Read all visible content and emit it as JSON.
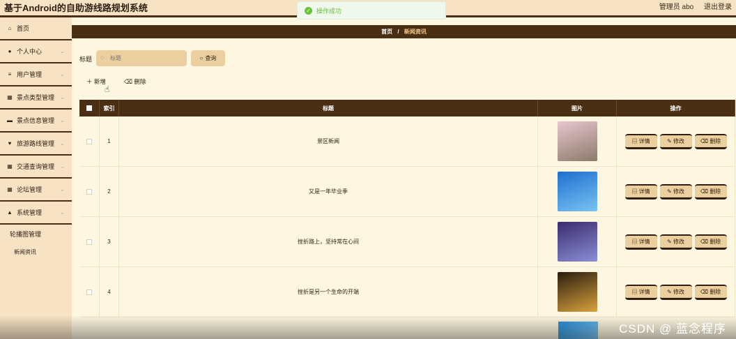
{
  "app": {
    "title": "基于Android的自助游线路规划系统"
  },
  "header": {
    "user_label": "管理员 abo",
    "logout": "退出登录"
  },
  "toast": {
    "message": "操作成功"
  },
  "sidebar": {
    "items": [
      {
        "label": "首页",
        "icon": "home-icon"
      },
      {
        "label": "个人中心",
        "icon": "user-icon"
      },
      {
        "label": "用户管理",
        "icon": "list-icon"
      },
      {
        "label": "景点类型管理",
        "icon": "grid-icon"
      },
      {
        "label": "景点信息管理",
        "icon": "chat-icon"
      },
      {
        "label": "旅游路线管理",
        "icon": "map-pin-icon"
      },
      {
        "label": "交通查询管理",
        "icon": "grid-icon"
      },
      {
        "label": "论坛管理",
        "icon": "grid-icon"
      },
      {
        "label": "系统管理",
        "icon": "user-icon"
      }
    ],
    "sub_items": [
      "轮播图管理",
      "新闻资讯"
    ]
  },
  "breadcrumb": {
    "home": "首页",
    "sep": "/",
    "current": "新闻资讯"
  },
  "search": {
    "label": "标题",
    "placeholder": "标题",
    "button": "查询"
  },
  "toolbar": {
    "add": "新增",
    "delete": "删除"
  },
  "table": {
    "columns": [
      "索引",
      "标题",
      "图片",
      "操作"
    ],
    "rows": [
      {
        "index": "1",
        "title": "景区新闻",
        "thumb_colors": [
          "#e7c6cf",
          "#8c7a6a"
        ]
      },
      {
        "index": "2",
        "title": "又是一年毕业季",
        "thumb_colors": [
          "#1f6fd0",
          "#78c3f2"
        ]
      },
      {
        "index": "3",
        "title": "挫折路上，坚持常在心间",
        "thumb_colors": [
          "#3b2b6e",
          "#8a8fd6"
        ]
      },
      {
        "index": "4",
        "title": "挫折是另一个生命的开端",
        "thumb_colors": [
          "#2a1d0e",
          "#d9a23e"
        ]
      }
    ],
    "ops": {
      "detail": "详情",
      "edit": "修改",
      "delete": "删除"
    }
  },
  "watermark": "CSDN @ 蓝念程序"
}
